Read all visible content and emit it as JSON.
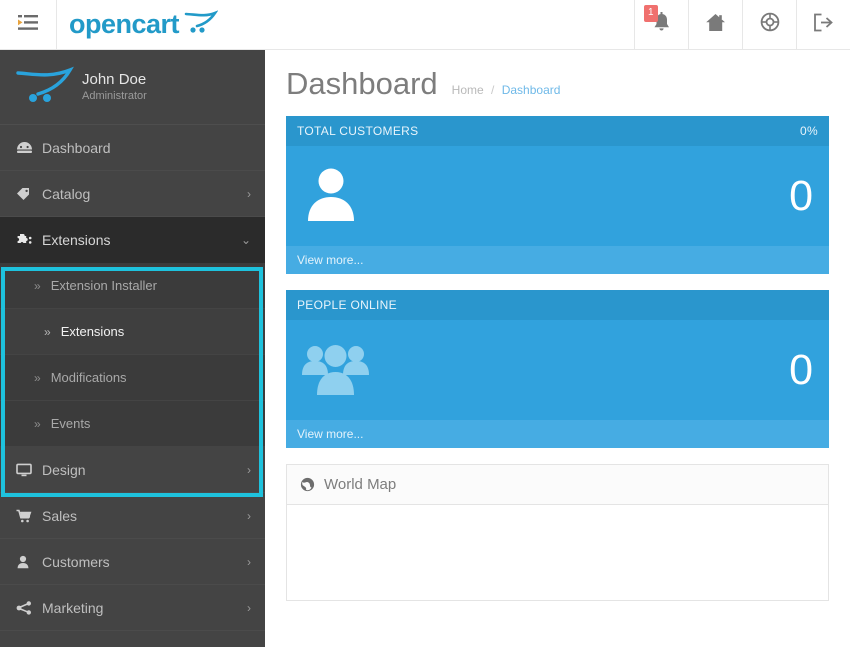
{
  "header": {
    "menu_toggle_icon": "list-indent-icon",
    "brand": "opencart",
    "brand_cart_icon": "shopping-cart-icon",
    "notification_badge": "1",
    "notification_icon": "bell-icon",
    "storefront_icon": "home-icon",
    "support_icon": "lifering-icon",
    "logout_icon": "logout-icon"
  },
  "sidebar": {
    "profile": {
      "logo_icon": "opencart-cart-icon",
      "name": "John Doe",
      "role": "Administrator"
    },
    "items": [
      {
        "label": "Dashboard",
        "icon": "tachometer-icon",
        "caret": ""
      },
      {
        "label": "Catalog",
        "icon": "tag-icon",
        "caret": "›"
      },
      {
        "label": "Extensions",
        "icon": "puzzle-piece-icon",
        "caret": "⌄"
      },
      {
        "label": "Design",
        "icon": "monitor-icon",
        "caret": "›"
      },
      {
        "label": "Sales",
        "icon": "cart-icon",
        "caret": "›"
      },
      {
        "label": "Customers",
        "icon": "user-icon",
        "caret": "›"
      },
      {
        "label": "Marketing",
        "icon": "share-icon",
        "caret": "›"
      }
    ],
    "extensions_submenu": [
      {
        "label": "Extension Installer",
        "chevron": "»"
      },
      {
        "label": "Extensions",
        "chevron": "»"
      },
      {
        "label": "Modifications",
        "chevron": "»"
      },
      {
        "label": "Events",
        "chevron": "»"
      }
    ],
    "highlight_color": "#1ec2dd"
  },
  "main": {
    "page_title": "Dashboard",
    "breadcrumb": {
      "home": "Home",
      "separator": "/",
      "current": "Dashboard"
    },
    "tiles": [
      {
        "title": "TOTAL CUSTOMERS",
        "percent": "0%",
        "icon": "single-user-icon",
        "value": "0",
        "footer": "View more..."
      },
      {
        "title": "PEOPLE ONLINE",
        "percent": "",
        "icon": "group-users-icon",
        "value": "0",
        "footer": "View more..."
      }
    ],
    "world_map_panel": {
      "icon": "globe-icon",
      "title": "World Map"
    }
  },
  "colors": {
    "brand": "#229ac8",
    "tile_header": "#2a96cd",
    "tile_body": "#31a2dd",
    "tile_footer": "#46ace3",
    "sidebar_bg": "#444444",
    "highlight": "#1ec2dd",
    "badge": "#f0706e"
  }
}
